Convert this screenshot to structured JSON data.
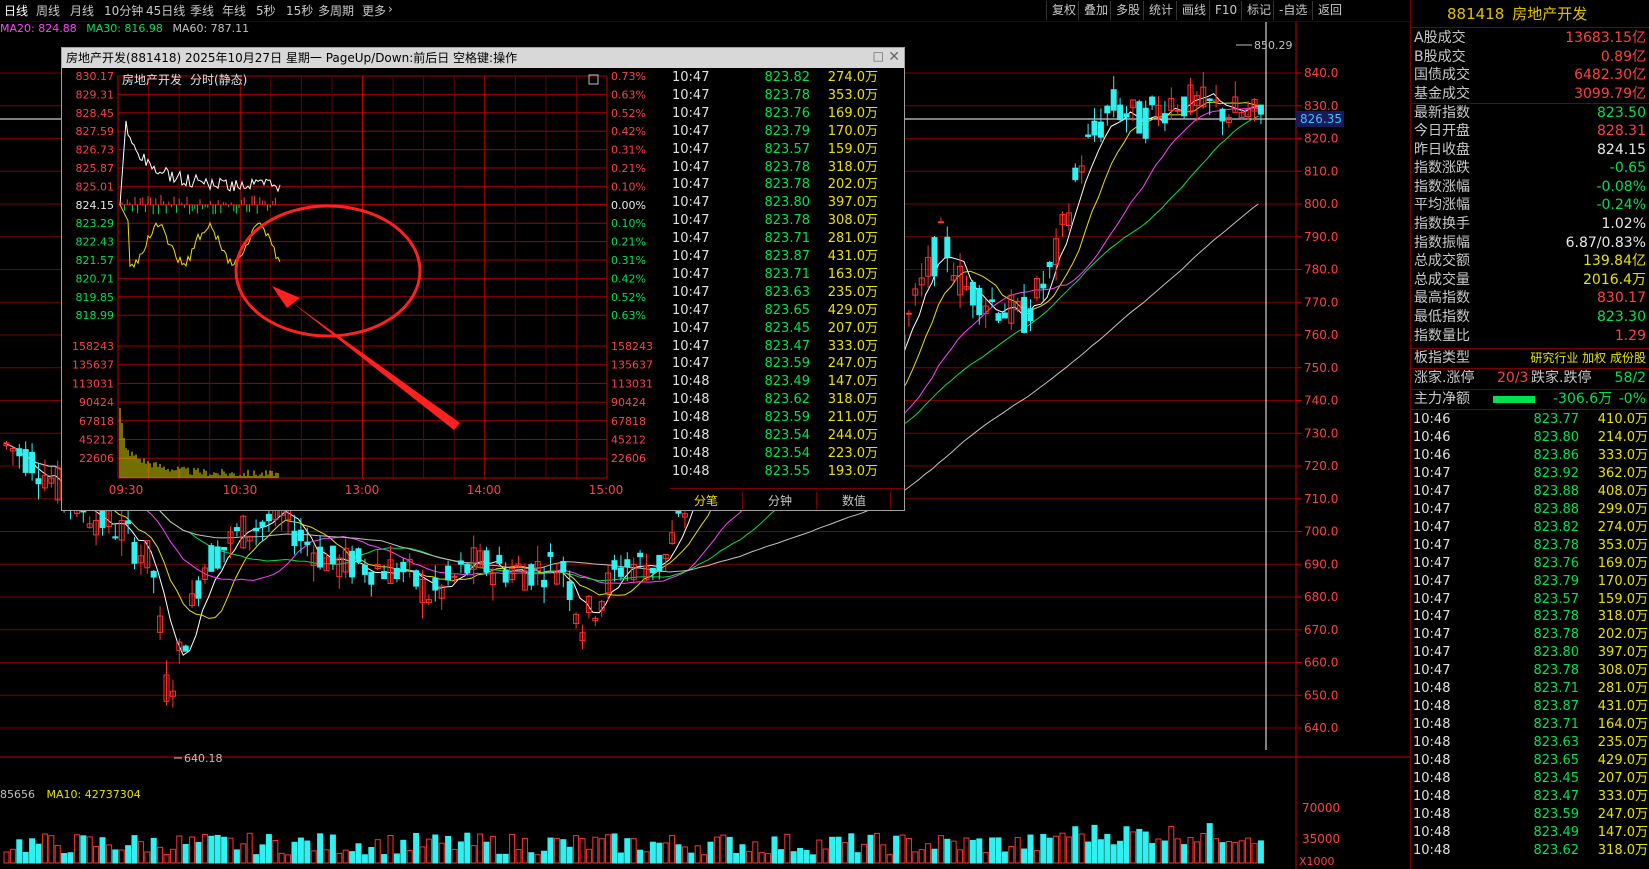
{
  "toolbar": {
    "tabs": [
      "日线",
      "周线",
      "月线",
      "10分钟",
      "45日线",
      "季线",
      "年线",
      "5秒",
      "15秒",
      "多周期",
      "更多"
    ],
    "more_arrow": "›",
    "buttons": [
      "复权",
      "叠加",
      "多股",
      "统计",
      "画线",
      "F10",
      "标记",
      "-自选",
      "返回"
    ]
  },
  "ma_legend": {
    "ma20": "MA20: 824.88",
    "ma30": "MA30: 816.98",
    "ma60": "MA60: 787.11"
  },
  "volume_legend": {
    "ma5": "85656",
    "ma10": "MA10: 42737304"
  },
  "price_axis": {
    "labels": [
      "840.0",
      "830.0",
      "820.0",
      "810.0",
      "800.0",
      "790.0",
      "780.0",
      "770.0",
      "760.0",
      "750.0",
      "740.0",
      "730.0",
      "720.0",
      "710.0",
      "700.0",
      "690.0",
      "680.0",
      "670.0",
      "660.0",
      "650.0",
      "640.0"
    ],
    "current_price_tag": "826.35",
    "high_label": "850.29",
    "low_label": "640.18"
  },
  "volume_axis": {
    "labels": [
      "70000",
      "35000"
    ],
    "unit": "X1000"
  },
  "colors": {
    "up": "#ff3030",
    "down": "#30f0f0",
    "ma5": "#ffffff",
    "ma10": "#e8e000",
    "ma20": "#ff40ff",
    "ma30": "#00e050",
    "ma60": "#c0c0c0",
    "grid": "#7a0000"
  },
  "popup": {
    "title": "房地产开发(881418) 2025年10月27日 星期一 PageUp/Down:前后日 空格键:操作",
    "chart_name": "房地产开发",
    "chart_mode": "分时(静态)",
    "left_prices": [
      "830.17",
      "829.31",
      "828.45",
      "827.59",
      "826.73",
      "825.87",
      "825.01",
      "824.15",
      "823.29",
      "822.43",
      "821.57",
      "820.71",
      "819.85",
      "818.99"
    ],
    "right_pcts": [
      "0.73%",
      "0.63%",
      "0.52%",
      "0.42%",
      "0.31%",
      "0.21%",
      "0.10%",
      "0.00%",
      "0.10%",
      "0.21%",
      "0.31%",
      "0.42%",
      "0.52%",
      "0.63%"
    ],
    "volume_labels": [
      "158243",
      "135637",
      "113031",
      "90424",
      "67818",
      "45212",
      "22606"
    ],
    "time_labels": [
      "09:30",
      "10:30",
      "13:00",
      "14:00",
      "15:00"
    ],
    "tabs": [
      "分笔",
      "分钟",
      "数值"
    ],
    "ticks": [
      {
        "t": "10:47",
        "p": "823.82",
        "v": "274.0万"
      },
      {
        "t": "10:47",
        "p": "823.78",
        "v": "353.0万"
      },
      {
        "t": "10:47",
        "p": "823.76",
        "v": "169.0万"
      },
      {
        "t": "10:47",
        "p": "823.79",
        "v": "170.0万"
      },
      {
        "t": "10:47",
        "p": "823.57",
        "v": "159.0万"
      },
      {
        "t": "10:47",
        "p": "823.78",
        "v": "318.0万"
      },
      {
        "t": "10:47",
        "p": "823.78",
        "v": "202.0万"
      },
      {
        "t": "10:47",
        "p": "823.80",
        "v": "397.0万"
      },
      {
        "t": "10:47",
        "p": "823.78",
        "v": "308.0万"
      },
      {
        "t": "10:47",
        "p": "823.71",
        "v": "281.0万"
      },
      {
        "t": "10:47",
        "p": "823.87",
        "v": "431.0万"
      },
      {
        "t": "10:47",
        "p": "823.71",
        "v": "163.0万"
      },
      {
        "t": "10:47",
        "p": "823.63",
        "v": "235.0万"
      },
      {
        "t": "10:47",
        "p": "823.65",
        "v": "429.0万"
      },
      {
        "t": "10:47",
        "p": "823.45",
        "v": "207.0万"
      },
      {
        "t": "10:47",
        "p": "823.47",
        "v": "333.0万"
      },
      {
        "t": "10:47",
        "p": "823.59",
        "v": "247.0万"
      },
      {
        "t": "10:48",
        "p": "823.49",
        "v": "147.0万"
      },
      {
        "t": "10:48",
        "p": "823.62",
        "v": "318.0万"
      },
      {
        "t": "10:48",
        "p": "823.59",
        "v": "211.0万"
      },
      {
        "t": "10:48",
        "p": "823.54",
        "v": "244.0万"
      },
      {
        "t": "10:48",
        "p": "823.54",
        "v": "223.0万"
      },
      {
        "t": "10:48",
        "p": "823.55",
        "v": "193.0万"
      }
    ]
  },
  "right_panel": {
    "code": "881418",
    "name": "房地产开发",
    "stats": [
      {
        "label": "A股成交",
        "value": "13683.15亿",
        "cls": "red"
      },
      {
        "label": "B股成交",
        "value": "0.89亿",
        "cls": "red"
      },
      {
        "label": "国债成交",
        "value": "6482.30亿",
        "cls": "red"
      },
      {
        "label": "基金成交",
        "value": "3099.79亿",
        "cls": "red"
      },
      {
        "label": "最新指数",
        "value": "823.50",
        "cls": "green"
      },
      {
        "label": "今日开盘",
        "value": "828.31",
        "cls": "red"
      },
      {
        "label": "昨日收盘",
        "value": "824.15",
        "cls": "white"
      },
      {
        "label": "指数涨跌",
        "value": "-0.65",
        "cls": "green"
      },
      {
        "label": "指数涨幅",
        "value": "-0.08%",
        "cls": "green"
      },
      {
        "label": "平均涨幅",
        "value": "-0.24%",
        "cls": "green"
      },
      {
        "label": "指数换手",
        "value": "1.02%",
        "cls": "white"
      },
      {
        "label": "指数振幅",
        "value": "6.87/0.83%",
        "cls": "white"
      },
      {
        "label": "总成交额",
        "value": "139.84亿",
        "cls": "yellow"
      },
      {
        "label": "总成交量",
        "value": "2016.4万",
        "cls": "yellow"
      },
      {
        "label": "最高指数",
        "value": "830.17",
        "cls": "red"
      },
      {
        "label": "最低指数",
        "value": "823.30",
        "cls": "green"
      },
      {
        "label": "指数量比",
        "value": "1.29",
        "cls": "red"
      }
    ],
    "industry_label": "板指类型",
    "industry_value": "研究行业 加权 成份股",
    "limit_up_label": "涨家.涨停",
    "limit_up_value": "20/3",
    "limit_down_label": "跌家.跌停",
    "limit_down_value": "58/2",
    "main_flow_label": "主力净额",
    "main_flow_value": "-306.6万",
    "main_flow_pct": "-0%",
    "ticks": [
      {
        "t": "10:46",
        "p": "823.77",
        "v": "410.0万"
      },
      {
        "t": "10:46",
        "p": "823.80",
        "v": "214.0万"
      },
      {
        "t": "10:46",
        "p": "823.86",
        "v": "333.0万"
      },
      {
        "t": "10:47",
        "p": "823.92",
        "v": "362.0万"
      },
      {
        "t": "10:47",
        "p": "823.88",
        "v": "408.0万"
      },
      {
        "t": "10:47",
        "p": "823.88",
        "v": "299.0万"
      },
      {
        "t": "10:47",
        "p": "823.82",
        "v": "274.0万"
      },
      {
        "t": "10:47",
        "p": "823.78",
        "v": "353.0万"
      },
      {
        "t": "10:47",
        "p": "823.76",
        "v": "169.0万"
      },
      {
        "t": "10:47",
        "p": "823.79",
        "v": "170.0万"
      },
      {
        "t": "10:47",
        "p": "823.57",
        "v": "159.0万"
      },
      {
        "t": "10:47",
        "p": "823.78",
        "v": "318.0万"
      },
      {
        "t": "10:47",
        "p": "823.78",
        "v": "202.0万"
      },
      {
        "t": "10:47",
        "p": "823.80",
        "v": "397.0万"
      },
      {
        "t": "10:47",
        "p": "823.78",
        "v": "308.0万"
      },
      {
        "t": "10:48",
        "p": "823.71",
        "v": "281.0万"
      },
      {
        "t": "10:48",
        "p": "823.87",
        "v": "431.0万"
      },
      {
        "t": "10:48",
        "p": "823.71",
        "v": "164.0万"
      },
      {
        "t": "10:48",
        "p": "823.63",
        "v": "235.0万"
      },
      {
        "t": "10:48",
        "p": "823.65",
        "v": "429.0万"
      },
      {
        "t": "10:48",
        "p": "823.45",
        "v": "207.0万"
      },
      {
        "t": "10:48",
        "p": "823.47",
        "v": "333.0万"
      },
      {
        "t": "10:48",
        "p": "823.59",
        "v": "247.0万"
      },
      {
        "t": "10:48",
        "p": "823.49",
        "v": "147.0万"
      },
      {
        "t": "10:48",
        "p": "823.62",
        "v": "318.0万"
      }
    ]
  }
}
